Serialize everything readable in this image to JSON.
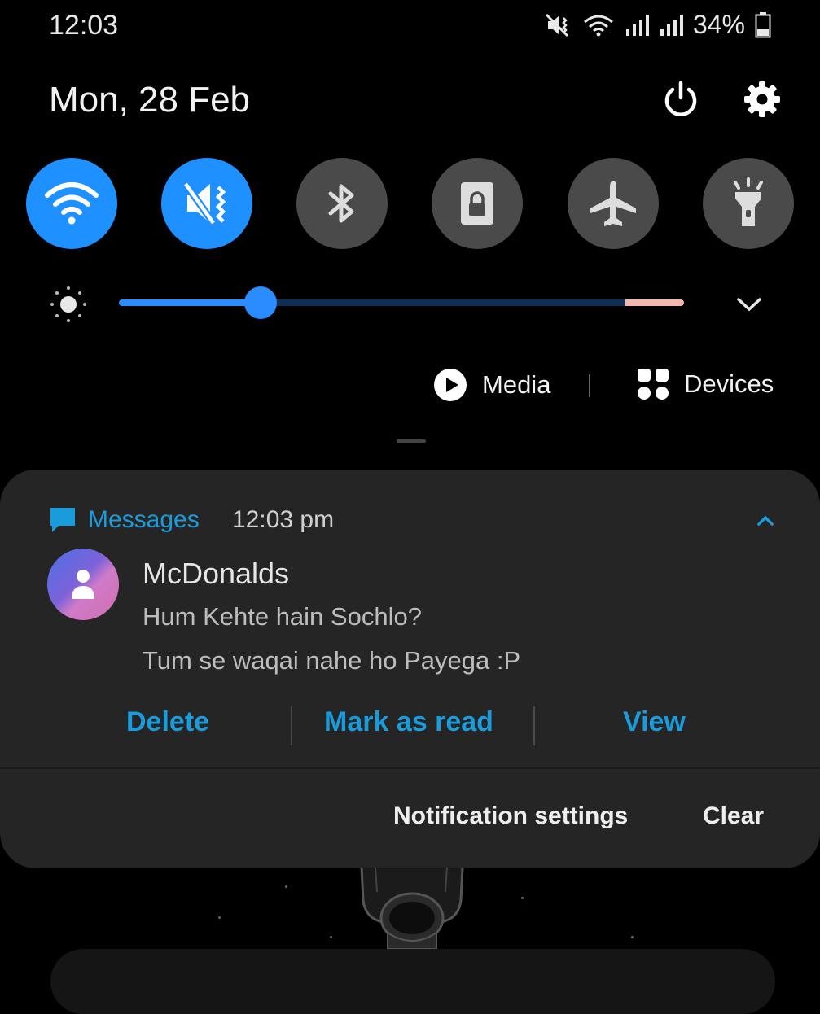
{
  "status_bar": {
    "time": "12:03",
    "battery_percent": "34%",
    "icons": [
      "vibrate-mute-icon",
      "wifi-icon",
      "signal-bars-icon",
      "signal-bars-icon",
      "battery-icon"
    ]
  },
  "header": {
    "date": "Mon, 28 Feb",
    "power_icon": "power-icon",
    "settings_icon": "gear-icon"
  },
  "quick_settings": {
    "tiles": [
      {
        "name": "wifi",
        "icon": "wifi-icon",
        "state": "on"
      },
      {
        "name": "sound",
        "icon": "vibrate-mute-icon",
        "state": "on"
      },
      {
        "name": "bluetooth",
        "icon": "bluetooth-icon",
        "state": "off"
      },
      {
        "name": "lock-screen",
        "icon": "lock-icon",
        "state": "off"
      },
      {
        "name": "airplane-mode",
        "icon": "airplane-icon",
        "state": "off"
      },
      {
        "name": "flashlight",
        "icon": "flashlight-icon",
        "state": "off"
      }
    ],
    "brightness_level": 0.25
  },
  "media_devices": {
    "media_label": "Media",
    "devices_label": "Devices"
  },
  "notification": {
    "app_name": "Messages",
    "time": "12:03 pm",
    "sender": "McDonalds",
    "messages": [
      "Hum Kehte hain Sochlo?",
      "Tum se waqai nahe ho Payega :P"
    ],
    "actions": {
      "delete": "Delete",
      "mark_read": "Mark as read",
      "view": "View"
    }
  },
  "footer": {
    "settings_label": "Notification settings",
    "clear_label": "Clear"
  },
  "colors": {
    "accent_blue": "#1e90ff",
    "link_blue": "#1a9bdc",
    "tile_off": "#4a4a4a",
    "panel_bg": "#252525"
  }
}
